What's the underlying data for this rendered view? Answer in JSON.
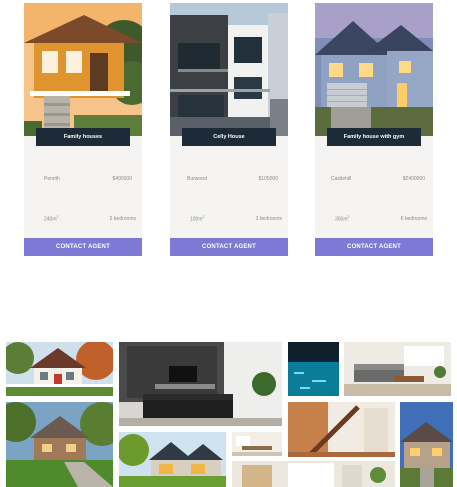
{
  "listings": [
    {
      "title": "Family houses",
      "location": "Penrith",
      "price": "$400000",
      "area": "240m",
      "area_unit_sup": "2",
      "bedrooms": "5 bedrooms",
      "cta": "CONTACT AGENT"
    },
    {
      "title": "Celly House",
      "location": "Burwood",
      "price": "$105000",
      "area": "100m",
      "area_unit_sup": "2",
      "bedrooms": "3 bedrooms",
      "cta": "CONTACT AGENT"
    },
    {
      "title": "Family house with gym",
      "location": "Castlehill",
      "price": "$2400000",
      "area": "300m",
      "area_unit_sup": "2",
      "bedrooms": "6 bedrooms",
      "cta": "CONTACT AGENT"
    }
  ],
  "colors": {
    "title_bar": "#1d2a38",
    "cta_button": "#7d79d4",
    "card_bg": "#f5f4f3"
  },
  "gallery": {
    "images": [
      "white-cottage-photo",
      "living-room-tv-photo",
      "pool-night-photo",
      "modern-living-room-photo",
      "stone-house-photo",
      "modern-house-photo",
      "dining-room-photo",
      "staircase-photo",
      "house-dusk-photo",
      "bright-room-photo"
    ]
  }
}
